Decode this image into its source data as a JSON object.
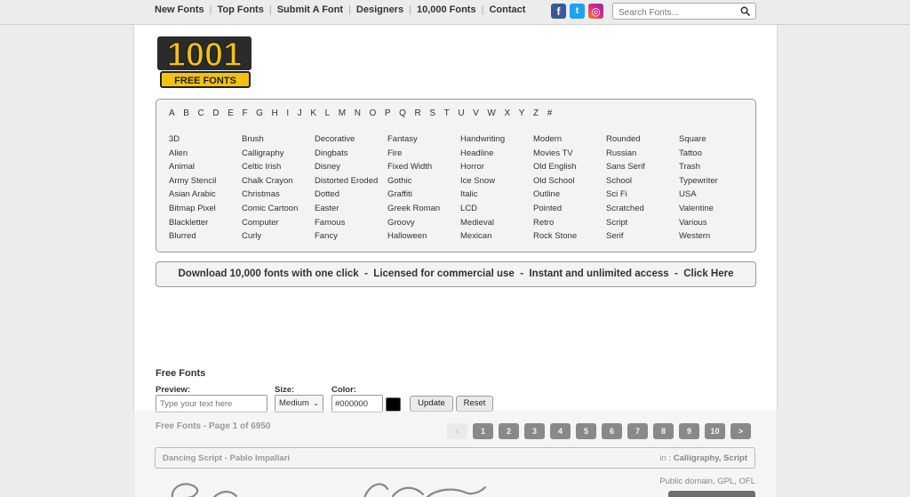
{
  "nav": {
    "items": [
      "New Fonts",
      "Top Fonts",
      "Submit A Font",
      "Designers",
      "10,000 Fonts",
      "Contact"
    ]
  },
  "social": {
    "facebook": "f",
    "twitter": "t",
    "instagram": "◎"
  },
  "search": {
    "placeholder": "Search Fonts..."
  },
  "logo": {
    "number": "1001",
    "tagline": "FREE FONTS"
  },
  "letters": [
    "A",
    "B",
    "C",
    "D",
    "E",
    "F",
    "G",
    "H",
    "I",
    "J",
    "K",
    "L",
    "M",
    "N",
    "O",
    "P",
    "Q",
    "R",
    "S",
    "T",
    "U",
    "V",
    "W",
    "X",
    "Y",
    "Z",
    "#"
  ],
  "categories": [
    [
      "3D",
      "Alien",
      "Animal",
      "Army Stencil",
      "Asian Arabic",
      "Bitmap Pixel",
      "Blackletter",
      "Blurred"
    ],
    [
      "Brush",
      "Calligraphy",
      "Celtic Irish",
      "Chalk Crayon",
      "Christmas",
      "Comic Cartoon",
      "Computer",
      "Curly"
    ],
    [
      "Decorative",
      "Dingbats",
      "Disney",
      "Distorted Eroded",
      "Dotted",
      "Easter",
      "Famous",
      "Fancy"
    ],
    [
      "Fantasy",
      "Fire",
      "Fixed Width",
      "Gothic",
      "Graffiti",
      "Greek Roman",
      "Groovy",
      "Halloween"
    ],
    [
      "Handwriting",
      "Headline",
      "Horror",
      "Ice Snow",
      "Italic",
      "LCD",
      "Medieval",
      "Mexican"
    ],
    [
      "Modern",
      "Movies TV",
      "Old English",
      "Old School",
      "Outline",
      "Pointed",
      "Retro",
      "Rock Stone"
    ],
    [
      "Rounded",
      "Russian",
      "Sans Serif",
      "School",
      "Sci Fi",
      "Scratched",
      "Script",
      "Serif"
    ],
    [
      "Square",
      "Tattoo",
      "Trash",
      "Typewriter",
      "USA",
      "Valentine",
      "Various",
      "Western"
    ]
  ],
  "download_bar": "Download 10,000 fonts with one click  -  Licensed for commercial use  -  Instant and unlimited access  -  Click Here",
  "free_fonts": {
    "heading": "Free Fonts",
    "preview_label": "Preview:",
    "preview_placeholder": "Type your text here",
    "size_label": "Size:",
    "size_value": "Medium",
    "color_label": "Color:",
    "color_value": "#000000",
    "update_label": "Update",
    "reset_label": "Reset",
    "page_info": "Free Fonts - Page 1 of 6950"
  },
  "pagination": [
    "<",
    "1",
    "2",
    "3",
    "4",
    "5",
    "6",
    "7",
    "8",
    "9",
    "10",
    ">"
  ],
  "font_entry": {
    "name": "Dancing Script - Pablo Impallari",
    "in_label": "in :",
    "categories": "Calligraphy, Script",
    "license": "Public domain, GPL, OFL"
  },
  "colors": {
    "accent_dark": "#111111",
    "logo_yellow": "#f4c20d",
    "page_bg": "#ececec"
  }
}
